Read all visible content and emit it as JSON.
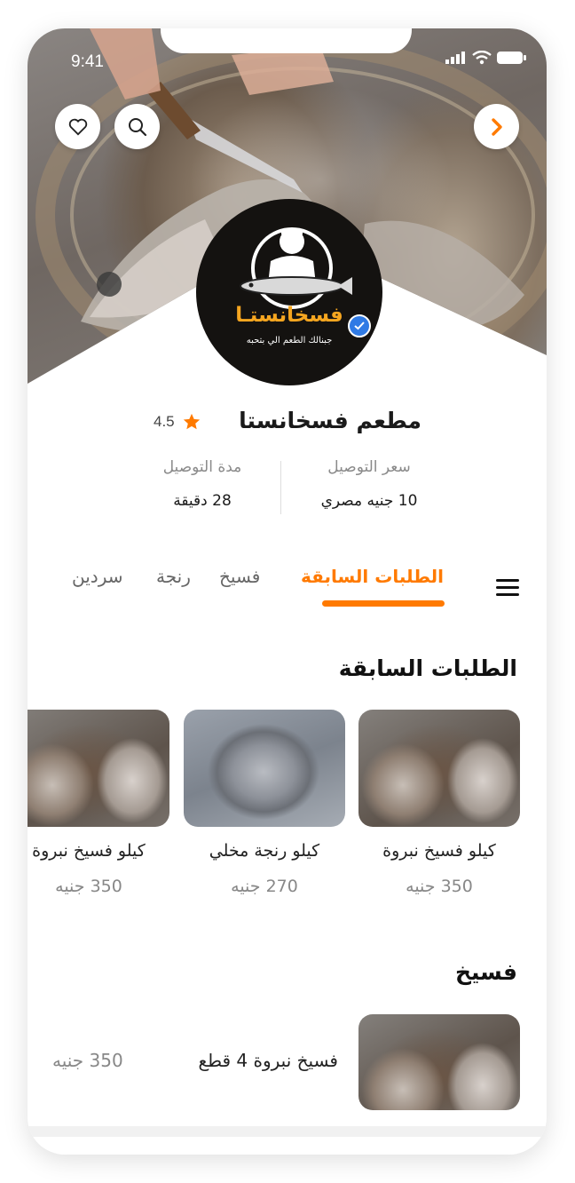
{
  "status_bar": {
    "time": "9:41"
  },
  "restaurant": {
    "name": "مطعم فسخانستا",
    "rating": "4.5",
    "logo_title": "فسخانستـا",
    "logo_tagline": "جبنالك الطعم الي بتحبه"
  },
  "delivery": {
    "price_label": "سعر التوصيل",
    "price_value": "10 جنيه مصري",
    "time_label": "مدة التوصيل",
    "time_value": "28 دقيقة"
  },
  "tabs": [
    {
      "label": "الطلبات السابقة",
      "active": true
    },
    {
      "label": "فسيخ",
      "active": false
    },
    {
      "label": "رنجة",
      "active": false
    },
    {
      "label": "سردين",
      "active": false
    }
  ],
  "sections": {
    "previous_orders": {
      "title": "الطلبات السابقة",
      "items": [
        {
          "name": "كيلو فسيخ نبروة",
          "price": "350 جنيه"
        },
        {
          "name": "كيلو رنجة مخلي",
          "price": "270 جنيه"
        },
        {
          "name": "كيلو فسيخ نبروة",
          "price": "350 جنيه"
        }
      ]
    },
    "fesikh": {
      "title": "فسيخ",
      "items": [
        {
          "name": "فسيخ نبروة 4 قطع",
          "price": "350 جنيه"
        }
      ]
    }
  },
  "icons": {
    "accent": "#ff7a00",
    "favorite": "heart-icon",
    "search": "search-icon",
    "back": "chevron-right-icon",
    "menu": "hamburger-icon",
    "rating": "star-icon",
    "verified": "verified-badge-icon"
  }
}
